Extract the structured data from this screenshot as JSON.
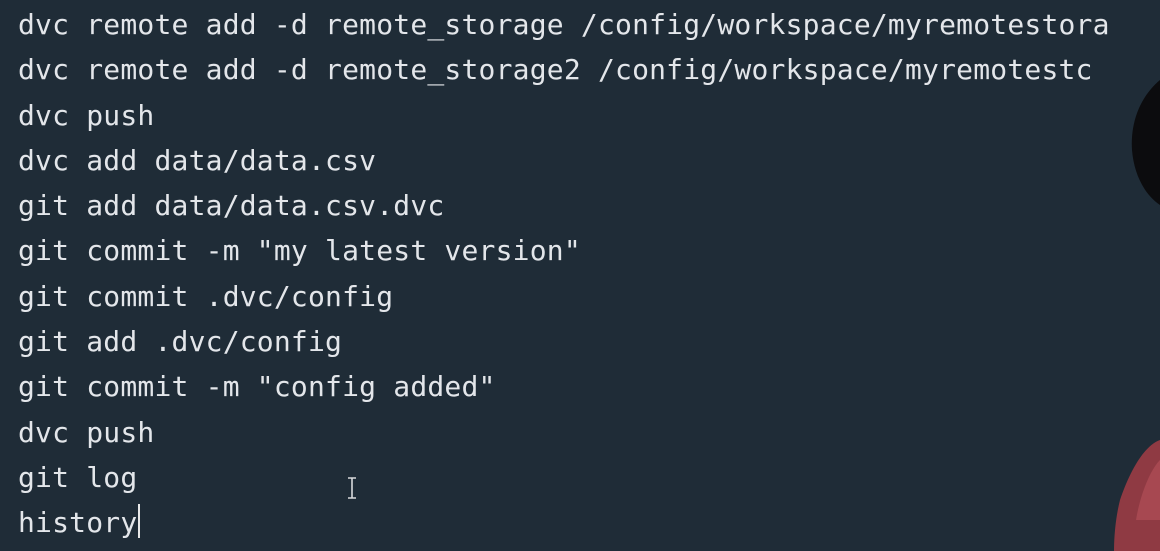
{
  "terminal": {
    "history": [
      "dvc remote add -d remote_storage /config/workspace/myremotestora",
      "dvc remote add -d remote_storage2 /config/workspace/myremotestc",
      "dvc push",
      "dvc add data/data.csv",
      "git add data/data.csv.dvc",
      "git commit -m \"my latest version\"",
      "git commit .dvc/config",
      "git add .dvc/config",
      "git commit -m \"config added\"",
      "dvc push",
      "git log"
    ],
    "current_input": "history"
  },
  "colors": {
    "background": "#1f2c37",
    "text": "#e3e6ea"
  }
}
